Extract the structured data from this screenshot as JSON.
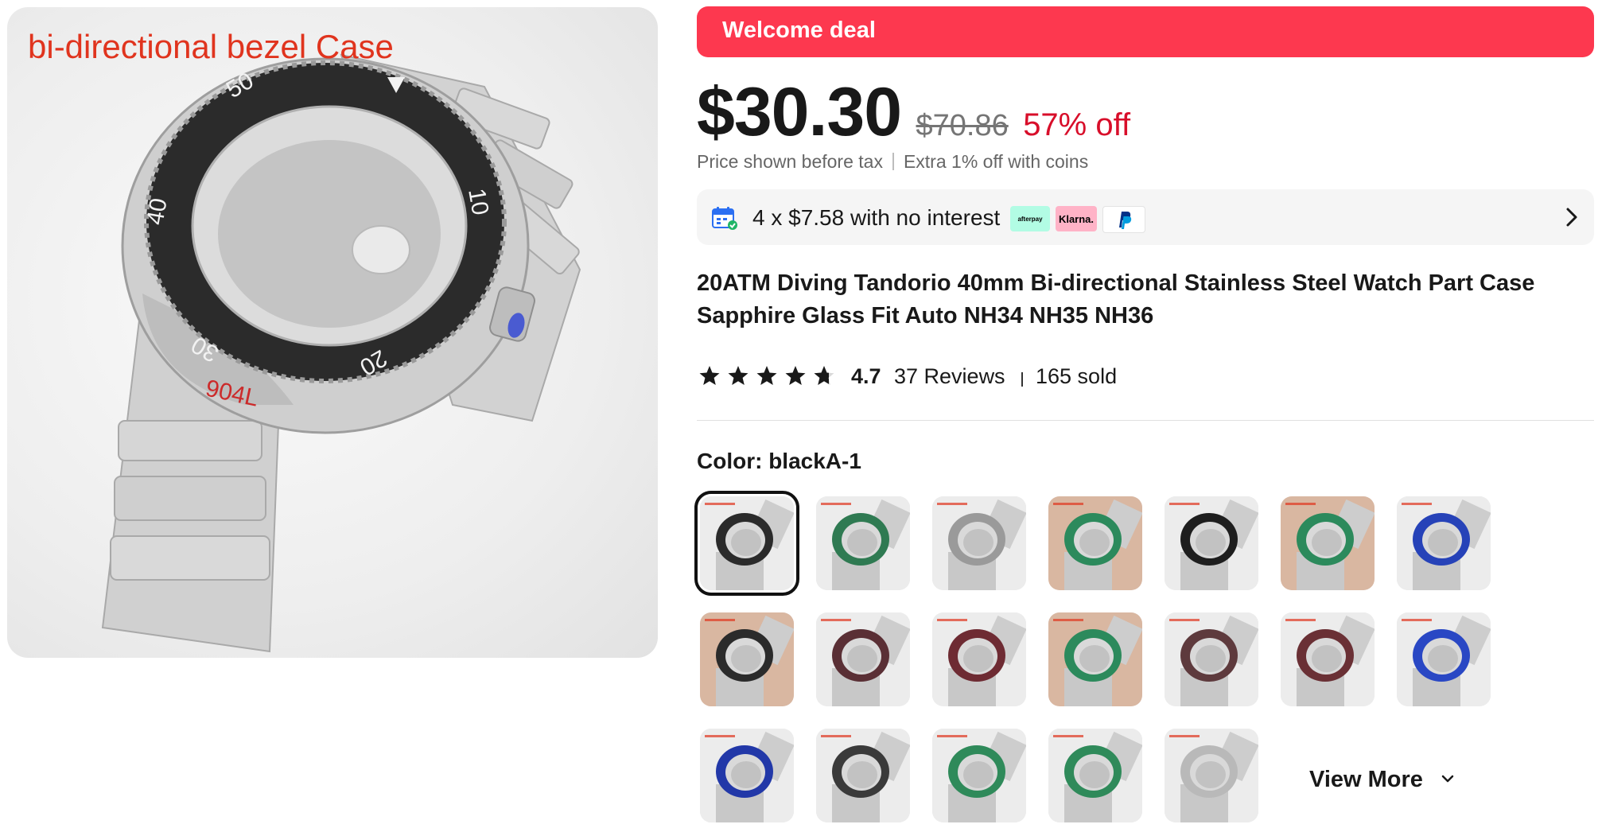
{
  "main_image": {
    "overlay_text": "bi-directional bezel Case",
    "bezel_numbers": [
      "50",
      "40",
      "30",
      "20",
      "10"
    ],
    "engraving": "904L"
  },
  "deal": {
    "label": "Welcome deal",
    "color": "#fd384f"
  },
  "price": {
    "current": "$30.30",
    "original": "$70.86",
    "discount": "57% off",
    "note_tax": "Price shown before tax",
    "note_coins": "Extra 1% off with coins"
  },
  "installment": {
    "text": "4 x $7.58 with no interest",
    "logos": {
      "afterpay": "afterpay",
      "klarna": "Klarna.",
      "paypal": "P"
    }
  },
  "product": {
    "title_line1": "20ATM Diving Tandorio 40mm Bi-directional Stainless Steel Watch Part Case",
    "title_line2": "Sapphire Glass Fit Auto NH34 NH35 NH36"
  },
  "rating": {
    "stars": 4.7,
    "value": "4.7",
    "reviews": "37 Reviews",
    "sold": "165 sold"
  },
  "color": {
    "label": "Color: blackA-1",
    "selected_index": 0,
    "swatch_bezels": [
      "#2b2b2b",
      "#2f7a52",
      "#9a9a9a",
      "#2c8a5c",
      "#1e1e1e",
      "#2c8a5c",
      "#2642b8",
      "#2b2b2b",
      "#5a2f35",
      "#6e2b33",
      "#2c8a5c",
      "#5e3a3d",
      "#6a3035",
      "#2947c4",
      "#2238a8",
      "#3a3a3a",
      "#2f8a5a",
      "#2f8a5a",
      "#b9b9b9"
    ]
  },
  "view_more": "View More"
}
